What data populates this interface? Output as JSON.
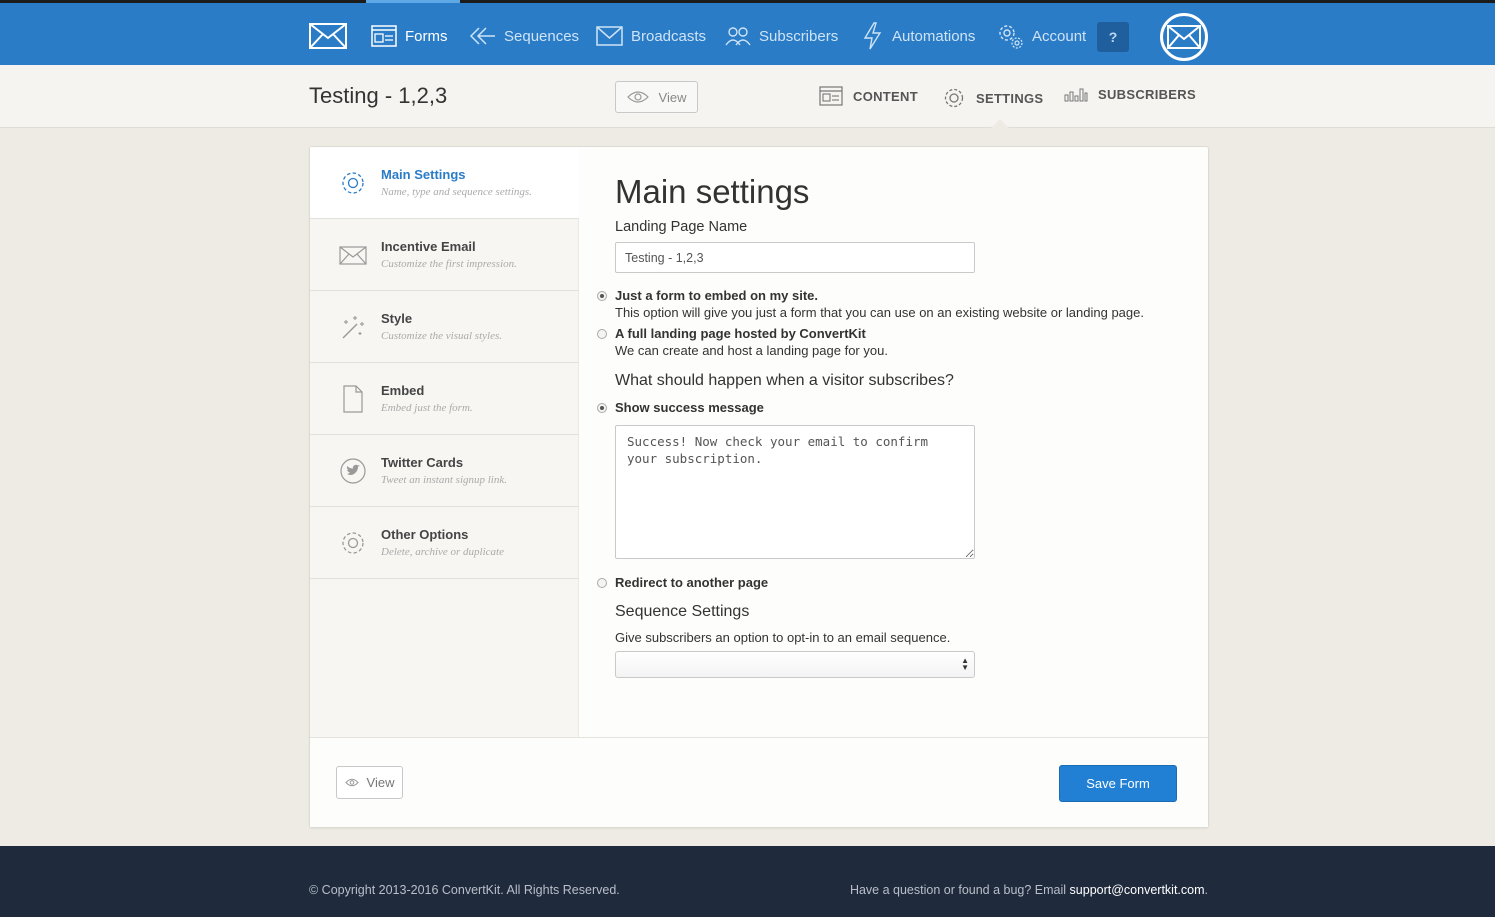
{
  "nav": {
    "items": [
      {
        "label": "Forms",
        "icon": "forms-icon"
      },
      {
        "label": "Sequences",
        "icon": "sequences-icon"
      },
      {
        "label": "Broadcasts",
        "icon": "broadcasts-icon"
      },
      {
        "label": "Subscribers",
        "icon": "subscribers-icon"
      },
      {
        "label": "Automations",
        "icon": "lightning-icon"
      },
      {
        "label": "Account",
        "icon": "gears-icon"
      }
    ],
    "help_label": "?"
  },
  "subheader": {
    "title": "Testing - 1,2,3",
    "view_label": "View",
    "tabs": [
      {
        "label": "CONTENT",
        "icon": "content-icon"
      },
      {
        "label": "SETTINGS",
        "icon": "gear-icon"
      },
      {
        "label": "SUBSCRIBERS",
        "icon": "bar-chart-icon"
      }
    ]
  },
  "sidebar": {
    "items": [
      {
        "title": "Main Settings",
        "desc": "Name, type and sequence settings.",
        "icon": "gear-icon"
      },
      {
        "title": "Incentive Email",
        "desc": "Customize the first impression.",
        "icon": "envelope-icon"
      },
      {
        "title": "Style",
        "desc": "Customize the visual styles.",
        "icon": "magic-wand-icon"
      },
      {
        "title": "Embed",
        "desc": "Embed just the form.",
        "icon": "document-icon"
      },
      {
        "title": "Twitter Cards",
        "desc": "Tweet an instant signup link.",
        "icon": "twitter-icon"
      },
      {
        "title": "Other Options",
        "desc": "Delete, archive or duplicate",
        "icon": "gear-icon"
      }
    ]
  },
  "main": {
    "heading": "Main settings",
    "name_label": "Landing Page Name",
    "name_value": "Testing - 1,2,3",
    "type_options": [
      {
        "title": "Just a form to embed on my site.",
        "desc": "This option will give you just a form that you can use on an existing website or landing page.",
        "selected": true
      },
      {
        "title": "A full landing page hosted by ConvertKit",
        "desc": "We can create and host a landing page for you.",
        "selected": false
      }
    ],
    "subscribe_question": "What should happen when a visitor subscribes?",
    "success_option": "Show success message",
    "success_message": "Success! Now check your email to confirm your subscription.",
    "redirect_option": "Redirect to another page",
    "sequence_heading": "Sequence Settings",
    "sequence_desc": "Give subscribers an option to opt-in to an email sequence.",
    "sequence_value": ""
  },
  "card_footer": {
    "view_label": "View",
    "save_label": "Save Form"
  },
  "footer": {
    "copyright": "© Copyright 2013-2016 ConvertKit. All Rights Reserved.",
    "help_text": "Have a question or found a bug? Email ",
    "support_email": "support@convertkit.com",
    "help_end": "."
  },
  "colors": {
    "brand_blue": "#2a7cc7",
    "save_button": "#2280d4",
    "footer_bg": "#1f2a3c"
  }
}
